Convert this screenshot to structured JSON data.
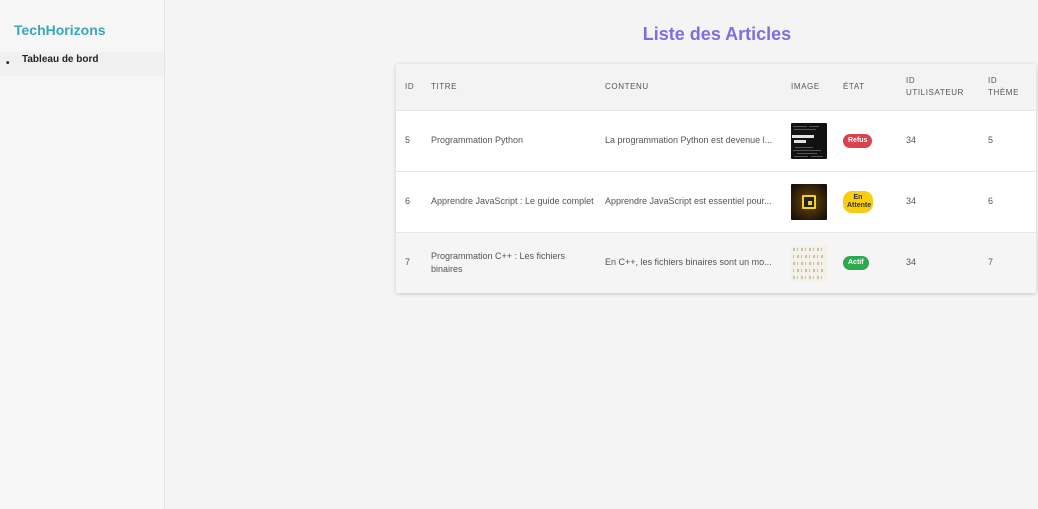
{
  "sidebar": {
    "brand": "TechHorizons",
    "items": [
      {
        "bullet": "•",
        "label": "Tableau de bord"
      }
    ]
  },
  "main": {
    "title": "Liste des Articles",
    "table": {
      "headers": {
        "id": "ID",
        "titre": "TITRE",
        "contenu": "CONTENU",
        "image": "IMAGE",
        "etat": "ÉTAT",
        "id_utilisateur_1": "ID",
        "id_utilisateur_2": "UTILISATEUR",
        "id_theme_1": "ID",
        "id_theme_2": "THÈME"
      },
      "rows": [
        {
          "id": "5",
          "titre": "Programmation Python",
          "contenu": "La programmation Python est devenue l...",
          "image_icon": "python-thumbnail",
          "etat": "Refus",
          "etat_color": "#d9434f",
          "id_utilisateur": "34",
          "id_theme": "5"
        },
        {
          "id": "6",
          "titre": "Apprendre JavaScript : Le guide complet",
          "contenu": "Apprendre JavaScript est essentiel pour...",
          "image_icon": "javascript-thumbnail",
          "etat": "En Attente",
          "etat_color": "#f7cd14",
          "id_utilisateur": "34",
          "id_theme": "6"
        },
        {
          "id": "7",
          "titre": "Programmation C++ : Les fichiers binaires",
          "contenu": "En C++, les fichiers binaires sont un mo...",
          "image_icon": "binary-thumbnail",
          "etat": "Actif",
          "etat_color": "#2fa84f",
          "id_utilisateur": "34",
          "id_theme": "7"
        }
      ]
    }
  }
}
